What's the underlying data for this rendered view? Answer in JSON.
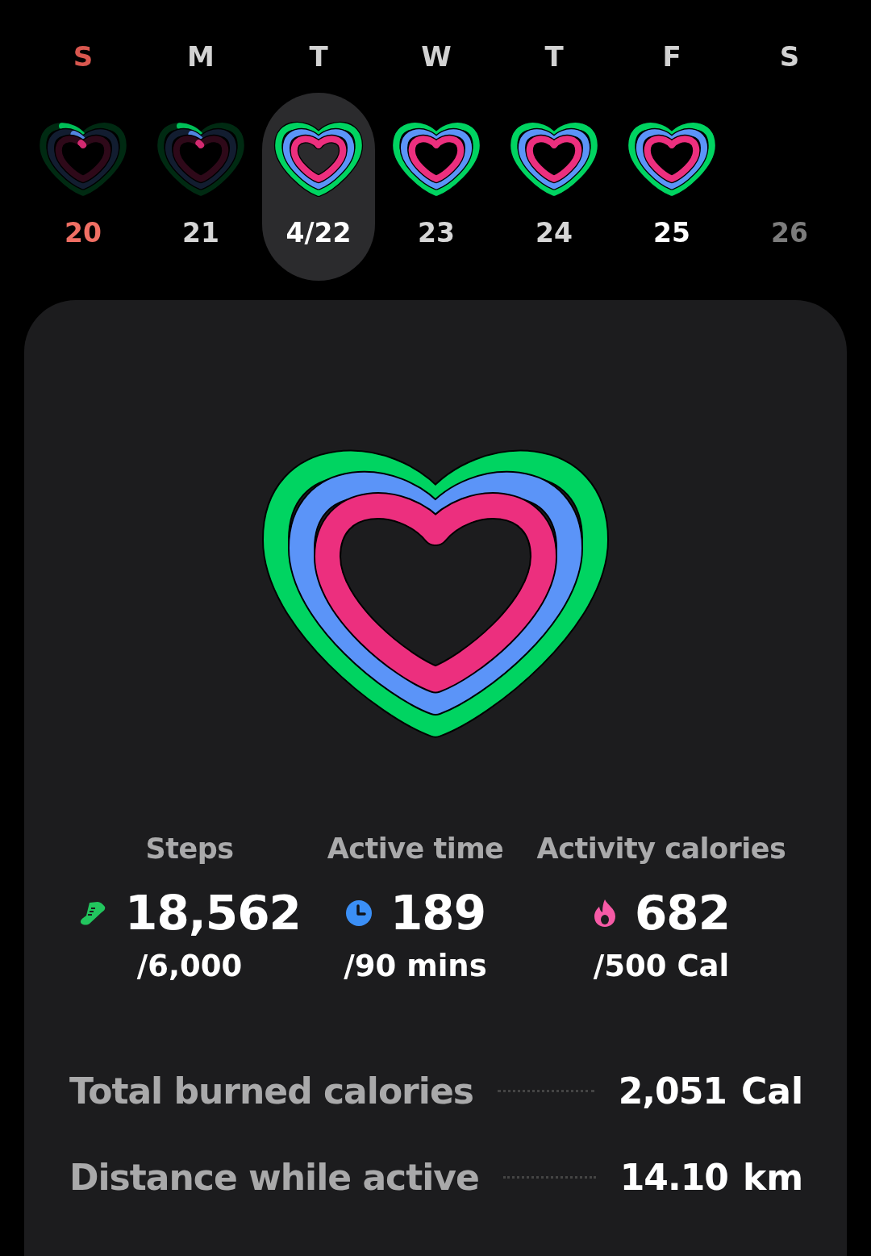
{
  "week": [
    {
      "letter": "S",
      "date": "20",
      "kind": "sunday",
      "selected": false,
      "today": false,
      "goals_met": false
    },
    {
      "letter": "M",
      "date": "21",
      "kind": "weekday",
      "selected": false,
      "today": false,
      "goals_met": false
    },
    {
      "letter": "T",
      "date": "4/22",
      "kind": "weekday",
      "selected": true,
      "today": false,
      "goals_met": true
    },
    {
      "letter": "W",
      "date": "23",
      "kind": "weekday",
      "selected": false,
      "today": false,
      "goals_met": true
    },
    {
      "letter": "T",
      "date": "24",
      "kind": "weekday",
      "selected": false,
      "today": false,
      "goals_met": true
    },
    {
      "letter": "F",
      "date": "25",
      "kind": "weekday",
      "selected": false,
      "today": true,
      "goals_met": true
    },
    {
      "letter": "S",
      "date": "26",
      "kind": "future",
      "selected": false,
      "today": false
    }
  ],
  "summary": {
    "stats": [
      {
        "kind": "steps",
        "label": "Steps",
        "value": "18,562",
        "goal": "/6,000"
      },
      {
        "kind": "active",
        "label": "Active time",
        "value": "189",
        "goal": "/90 mins"
      },
      {
        "kind": "calories",
        "label": "Activity calories",
        "value": "682",
        "goal": "/500 Cal"
      }
    ],
    "rows": [
      {
        "label": "Total burned calories",
        "value": "2,051",
        "unit": "Cal"
      },
      {
        "label": "Distance while active",
        "value": "14.10",
        "unit": "km"
      }
    ]
  }
}
